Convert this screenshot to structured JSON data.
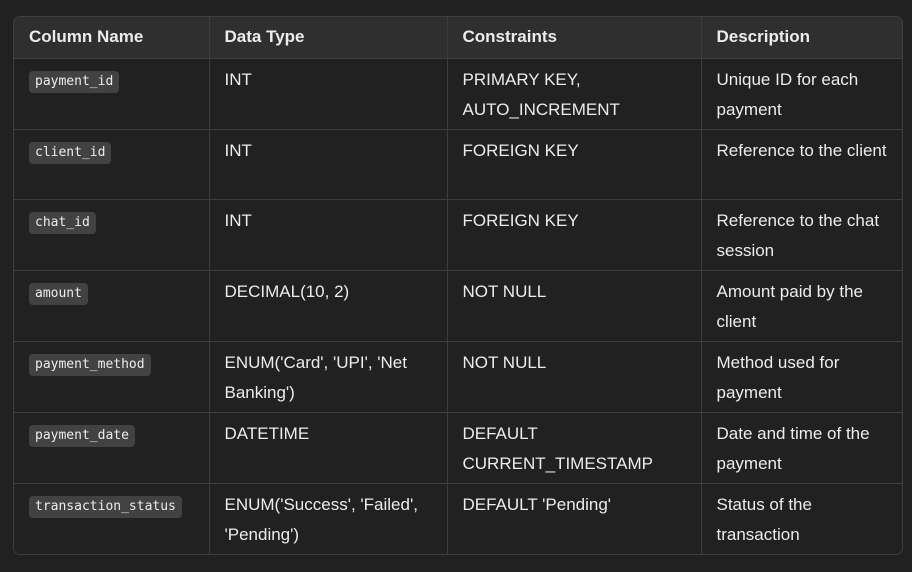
{
  "table": {
    "headers": [
      "Column Name",
      "Data Type",
      "Constraints",
      "Description"
    ],
    "rows": [
      {
        "column": "payment_id",
        "type": "INT",
        "constraints": "PRIMARY KEY, AUTO_INCREMENT",
        "description": "Unique ID for each payment"
      },
      {
        "column": "client_id",
        "type": "INT",
        "constraints": "FOREIGN KEY",
        "description": "Reference to the client"
      },
      {
        "column": "chat_id",
        "type": "INT",
        "constraints": "FOREIGN KEY",
        "description": "Reference to the chat session"
      },
      {
        "column": "amount",
        "type": "DECIMAL(10, 2)",
        "constraints": "NOT NULL",
        "description": "Amount paid by the client"
      },
      {
        "column": "payment_method",
        "type": "ENUM('Card', 'UPI', 'Net Banking')",
        "constraints": "NOT NULL",
        "description": "Method used for payment"
      },
      {
        "column": "payment_date",
        "type": "DATETIME",
        "constraints": "DEFAULT CURRENT_TIMESTAMP",
        "description": "Date and time of the payment"
      },
      {
        "column": "transaction_status",
        "type": "ENUM('Success', 'Failed', 'Pending')",
        "constraints": "DEFAULT 'Pending'",
        "description": "Status of the transaction"
      }
    ]
  }
}
